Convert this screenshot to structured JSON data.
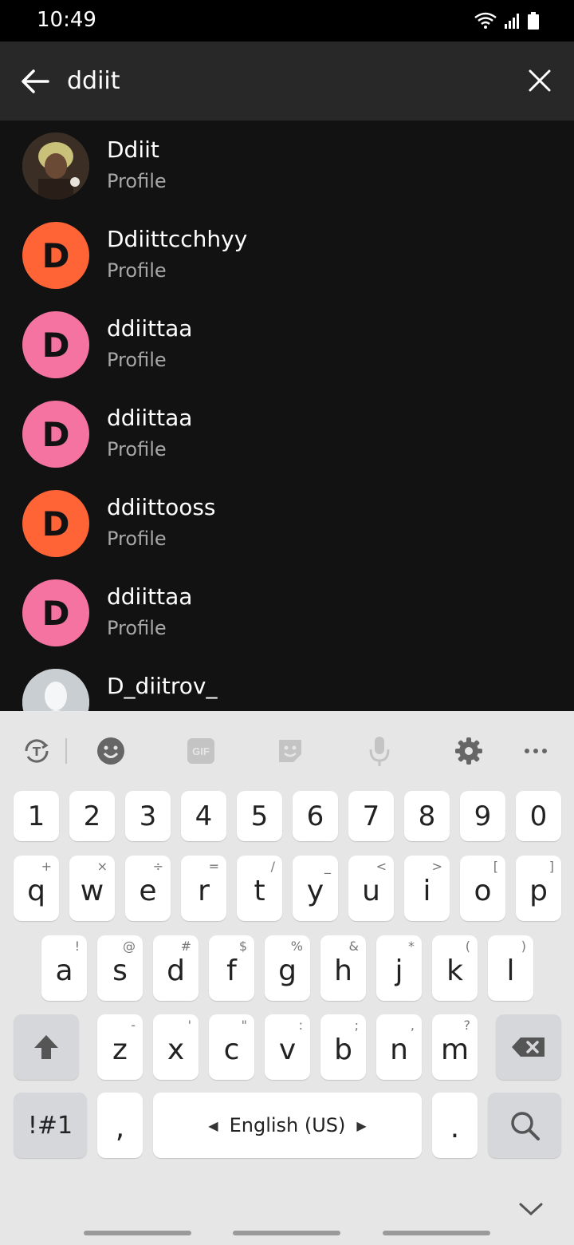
{
  "status": {
    "time": "10:49"
  },
  "search": {
    "query": "ddiit"
  },
  "results": [
    {
      "name": "Ddiit",
      "subtitle": "Profile",
      "avatar_letter": "",
      "avatar_color": "#5a4a3a",
      "photo": true
    },
    {
      "name": "Ddiittcchhyy",
      "subtitle": "Profile",
      "avatar_letter": "D",
      "avatar_color": "#ff6437"
    },
    {
      "name": "ddiittaa",
      "subtitle": "Profile",
      "avatar_letter": "D",
      "avatar_color": "#f573a0"
    },
    {
      "name": "ddiittaa",
      "subtitle": "Profile",
      "avatar_letter": "D",
      "avatar_color": "#f573a0"
    },
    {
      "name": "ddiittooss",
      "subtitle": "Profile",
      "avatar_letter": "D",
      "avatar_color": "#ff6437"
    },
    {
      "name": "ddiittaa",
      "subtitle": "Profile",
      "avatar_letter": "D",
      "avatar_color": "#f573a0"
    },
    {
      "name": "D_diitrov_",
      "subtitle": "",
      "avatar_letter": "",
      "avatar_color": "#c9ced3",
      "photo": true
    }
  ],
  "keyboard": {
    "toolbar": [
      "translate-icon",
      "emoji-icon",
      "gif-icon",
      "sticker-icon",
      "mic-icon",
      "settings-icon",
      "more-icon"
    ],
    "gif_label": "GIF",
    "number_row": [
      "1",
      "2",
      "3",
      "4",
      "5",
      "6",
      "7",
      "8",
      "9",
      "0"
    ],
    "row1": [
      {
        "k": "q",
        "a": "+"
      },
      {
        "k": "w",
        "a": "×"
      },
      {
        "k": "e",
        "a": "÷"
      },
      {
        "k": "r",
        "a": "="
      },
      {
        "k": "t",
        "a": "/"
      },
      {
        "k": "y",
        "a": "_"
      },
      {
        "k": "u",
        "a": "<"
      },
      {
        "k": "i",
        "a": ">"
      },
      {
        "k": "o",
        "a": "["
      },
      {
        "k": "p",
        "a": "]"
      }
    ],
    "row2": [
      {
        "k": "a",
        "a": "!"
      },
      {
        "k": "s",
        "a": "@"
      },
      {
        "k": "d",
        "a": "#"
      },
      {
        "k": "f",
        "a": "$"
      },
      {
        "k": "g",
        "a": "%"
      },
      {
        "k": "h",
        "a": "&"
      },
      {
        "k": "j",
        "a": "*"
      },
      {
        "k": "k",
        "a": "("
      },
      {
        "k": "l",
        "a": ")"
      }
    ],
    "row3": [
      {
        "k": "z",
        "a": "-"
      },
      {
        "k": "x",
        "a": "'"
      },
      {
        "k": "c",
        "a": "\""
      },
      {
        "k": "v",
        "a": ":"
      },
      {
        "k": "b",
        "a": ";"
      },
      {
        "k": "n",
        "a": ","
      },
      {
        "k": "m",
        "a": "?"
      }
    ],
    "symbols_label": "!#1",
    "comma_label": ",",
    "language_label": "English (US)",
    "period_label": "."
  }
}
